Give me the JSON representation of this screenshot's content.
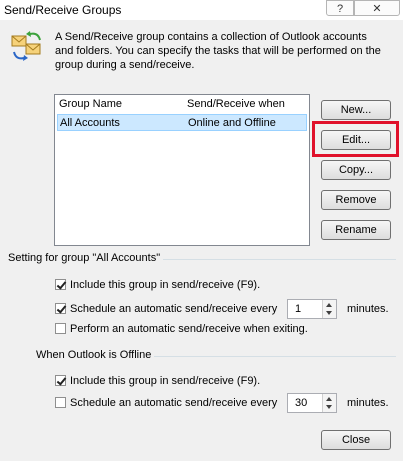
{
  "window": {
    "title": "Send/Receive Groups",
    "help_label": "?",
    "close_label": "✕"
  },
  "description": "A Send/Receive group contains a collection of Outlook accounts and folders. You can specify the tasks that will be performed on the group during a send/receive.",
  "list": {
    "columns": [
      "Group Name",
      "Send/Receive when"
    ],
    "rows": [
      {
        "name": "All Accounts",
        "when": "Online and Offline",
        "selected": true
      }
    ]
  },
  "buttons": {
    "new": "New...",
    "edit": "Edit...",
    "copy": "Copy...",
    "remove": "Remove",
    "rename": "Rename",
    "close": "Close"
  },
  "online_group": {
    "label": "Setting for group \"All Accounts\"",
    "include": {
      "label": "Include this group in send/receive (F9).",
      "checked": true
    },
    "schedule": {
      "label": "Schedule an automatic send/receive every",
      "checked": true,
      "value": "1",
      "unit": "minutes."
    },
    "on_exit": {
      "label": "Perform an automatic send/receive when exiting.",
      "checked": false
    }
  },
  "offline_group": {
    "label": "When Outlook is Offline",
    "include": {
      "label": "Include this group in send/receive (F9).",
      "checked": true
    },
    "schedule": {
      "label": "Schedule an automatic send/receive every",
      "checked": false,
      "value": "30",
      "unit": "minutes."
    }
  },
  "icons": {
    "group_icon": "send-receive-groups-icon",
    "highlight_color": "#e0112b"
  }
}
